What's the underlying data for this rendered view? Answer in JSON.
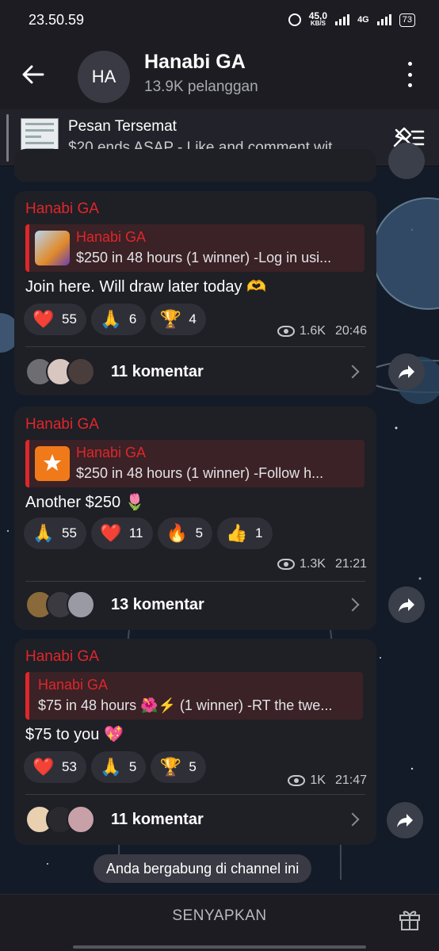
{
  "status": {
    "time": "23.50.59",
    "net_speed": "45,0",
    "net_unit": "KB/S",
    "network": "4G",
    "battery": "73"
  },
  "header": {
    "avatar_initials": "HA",
    "title": "Hanabi GA",
    "subtitle": "13.9K pelanggan"
  },
  "pinned": {
    "title": "Pesan Tersemat",
    "text": "$20 ends ASAP  - Like and comment wit..."
  },
  "messages": [
    {
      "author": "Hanabi GA",
      "reply_name": "Hanabi GA",
      "reply_text": "$250 in 48 hours (1 winner)  -Log in usi...",
      "text": "Join here. Will draw later today 🫶",
      "reactions": [
        {
          "emoji": "❤️",
          "count": "55"
        },
        {
          "emoji": "🙏",
          "count": "6"
        },
        {
          "emoji": "🏆",
          "count": "4"
        }
      ],
      "views": "1.6K",
      "time": "20:46",
      "comments": "11 komentar"
    },
    {
      "author": "Hanabi GA",
      "reply_name": "Hanabi GA",
      "reply_text": "$250 in 48 hours  (1 winner)   -Follow h...",
      "text": "Another $250 🌷",
      "reactions": [
        {
          "emoji": "🙏",
          "count": "55"
        },
        {
          "emoji": "❤️",
          "count": "11"
        },
        {
          "emoji": "🔥",
          "count": "5"
        },
        {
          "emoji": "👍",
          "count": "1"
        }
      ],
      "views": "1.3K",
      "time": "21:21",
      "comments": "13 komentar"
    },
    {
      "author": "Hanabi GA",
      "reply_name": "Hanabi GA",
      "reply_text": "$75 in 48 hours 🌺⚡ (1 winner)  -RT the twe...",
      "text": "$75 to you 💖",
      "reactions": [
        {
          "emoji": "❤️",
          "count": "53"
        },
        {
          "emoji": "🙏",
          "count": "5"
        },
        {
          "emoji": "🏆",
          "count": "5"
        }
      ],
      "views": "1K",
      "time": "21:47",
      "comments": "11 komentar"
    }
  ],
  "join_notice": "Anda bergabung di channel ini",
  "bottom": {
    "mute_label": "SENYAPKAN"
  },
  "icons": {
    "back": "arrow-left-icon",
    "more": "more-vertical-icon",
    "pin": "unpin-list-icon",
    "share": "share-forward-icon",
    "gift": "gift-icon",
    "views": "eye-icon"
  },
  "colors": {
    "accent_red": "#e0262a",
    "bubble": "#1f1f26",
    "header": "#1c1c22"
  }
}
